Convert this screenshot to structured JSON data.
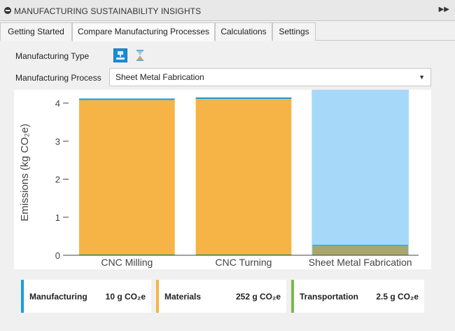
{
  "window": {
    "title": "MANUFACTURING SUSTAINABILITY INSIGHTS",
    "expand_icon": "double-chevron-right-icon"
  },
  "tabs": [
    {
      "label": "Getting Started",
      "active": false
    },
    {
      "label": "Compare Manufacturing Processes",
      "active": true
    },
    {
      "label": "Calculations",
      "active": false
    },
    {
      "label": "Settings",
      "active": false
    }
  ],
  "manufacturing_type": {
    "label": "Manufacturing Type",
    "options": [
      {
        "icon": "machine-tool-icon",
        "selected": true
      },
      {
        "icon": "hourglass-icon",
        "selected": false
      }
    ]
  },
  "manufacturing_process": {
    "label": "Manufacturing Process",
    "value": "Sheet Metal Fabrication"
  },
  "colors": {
    "manufacturing": "#1b9dd8",
    "materials": "#f7b446",
    "transportation": "#7cb94a",
    "highlight": "#a6d9f9",
    "selected_bar": "#a6a66e"
  },
  "chart_data": {
    "type": "bar",
    "stacked": true,
    "ylabel": "Emissions (kg CO₂e)",
    "xlabel": "",
    "ylim": [
      0,
      4.3
    ],
    "yticks": [
      0,
      1,
      2,
      3,
      4
    ],
    "categories": [
      "CNC Milling",
      "CNC Turning",
      "Sheet Metal Fabrication"
    ],
    "highlighted_category": "Sheet Metal Fabrication",
    "series": [
      {
        "name": "Transportation",
        "values": [
          0.03,
          0.03,
          0.003
        ]
      },
      {
        "name": "Materials",
        "values": [
          4.05,
          4.08,
          0.25
        ]
      },
      {
        "name": "Manufacturing",
        "values": [
          0.04,
          0.04,
          0.02
        ]
      }
    ]
  },
  "legend": [
    {
      "label": "Manufacturing",
      "value": "10 g CO₂e",
      "color": "#1b9dd8"
    },
    {
      "label": "Materials",
      "value": "252 g CO₂e",
      "color": "#f7b446"
    },
    {
      "label": "Transportation",
      "value": "2.5 g CO₂e",
      "color": "#7cb94a"
    }
  ]
}
